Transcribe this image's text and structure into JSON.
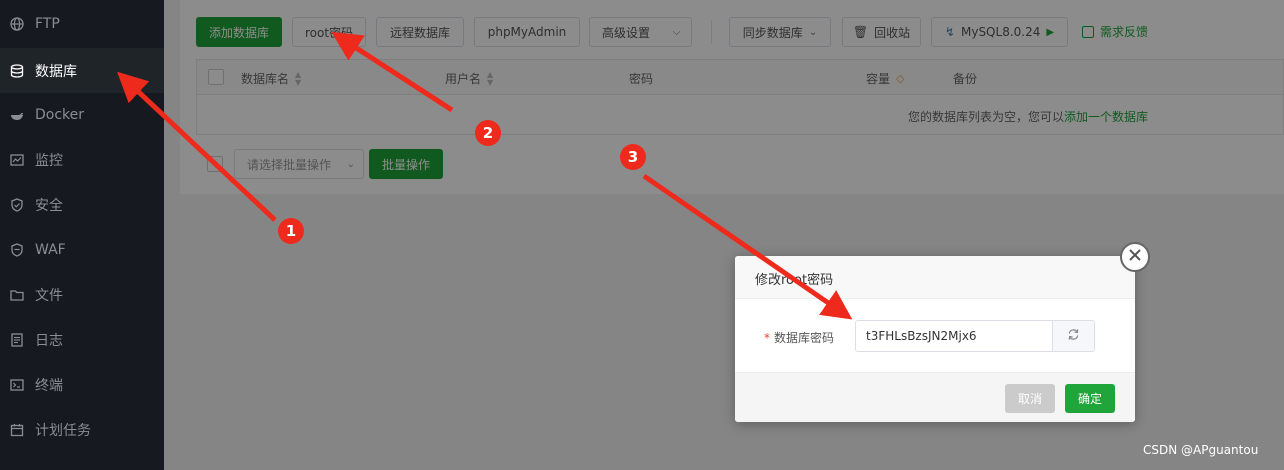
{
  "sidebar": {
    "items": [
      {
        "label": "FTP",
        "icon": "globe-icon",
        "active": false
      },
      {
        "label": "数据库",
        "icon": "database-icon",
        "active": true
      },
      {
        "label": "Docker",
        "icon": "docker-icon",
        "active": false
      },
      {
        "label": "监控",
        "icon": "monitor-icon",
        "active": false
      },
      {
        "label": "安全",
        "icon": "shield-icon",
        "active": false
      },
      {
        "label": "WAF",
        "icon": "waf-shield-icon",
        "active": false
      },
      {
        "label": "文件",
        "icon": "folder-icon",
        "active": false
      },
      {
        "label": "日志",
        "icon": "log-icon",
        "active": false
      },
      {
        "label": "终端",
        "icon": "terminal-icon",
        "active": false
      },
      {
        "label": "计划任务",
        "icon": "calendar-icon",
        "active": false
      }
    ]
  },
  "toolbar": {
    "add_db": "添加数据库",
    "root_pwd": "root密码",
    "remote_db": "远程数据库",
    "phpmyadmin": "phpMyAdmin",
    "advanced": "高级设置",
    "sync_db": "同步数据库",
    "recycle": "回收站",
    "mysql_version": "MySQL8.0.24",
    "feedback": "需求反馈"
  },
  "table": {
    "headers": {
      "db_name": "数据库名",
      "user": "用户名",
      "password": "密码",
      "capacity": "容量",
      "backup": "备份"
    },
    "empty_text": "您的数据库列表为空，您可以",
    "empty_link": "添加一个数据库"
  },
  "batch": {
    "placeholder": "请选择批量操作",
    "button": "批量操作"
  },
  "dialog": {
    "title": "修改root密码",
    "field_label": "数据库密码",
    "field_value": "t3FHLsBzsJN2Mjx6",
    "cancel": "取消",
    "ok": "确定"
  },
  "annotations": {
    "badges": [
      "1",
      "2",
      "3"
    ],
    "color": "#ee2a1c"
  },
  "watermark": "CSDN @APguantou",
  "colors": {
    "accent": "#20a53a",
    "sidebar_bg": "#161a20"
  }
}
